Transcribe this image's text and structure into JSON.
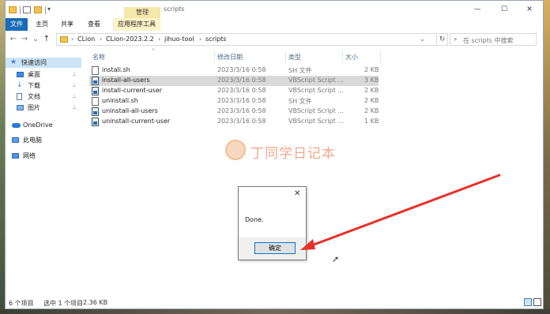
{
  "window": {
    "title": "scripts",
    "context_tab": "管理",
    "controls": {
      "minimize": "—",
      "maximize": "☐",
      "close": "✕"
    }
  },
  "ribbon": {
    "tabs": [
      "文件",
      "主页",
      "共享",
      "查看",
      "应用程序工具"
    ],
    "colors": {
      "file_tab": "#1a6cb8",
      "context_tab": "#f6e8a8"
    }
  },
  "navigation": {
    "back": "←",
    "forward": "→",
    "recent": "⌄",
    "up": "↑",
    "breadcrumb": [
      "CLion",
      "CLion-2023.2.2",
      "jihuo-tool",
      "scripts"
    ],
    "separator": "›",
    "refresh": "↻",
    "search_placeholder": "在 scripts 中搜索",
    "help": "?"
  },
  "sidebar": {
    "items": [
      {
        "label": "快速访问",
        "icon": "star-icon",
        "pinned": false,
        "selected": true
      },
      {
        "label": "桌面",
        "icon": "desktop-icon",
        "pinned": true
      },
      {
        "label": "下载",
        "icon": "download-icon",
        "pinned": true
      },
      {
        "label": "文档",
        "icon": "documents-icon",
        "pinned": true
      },
      {
        "label": "图片",
        "icon": "pictures-icon",
        "pinned": true
      },
      {
        "label": "OneDrive",
        "icon": "cloud-icon",
        "pinned": false
      },
      {
        "label": "此电脑",
        "icon": "computer-icon",
        "pinned": false
      },
      {
        "label": "网络",
        "icon": "network-icon",
        "pinned": false
      }
    ],
    "pin_glyph": "📌"
  },
  "file_list": {
    "columns": [
      "名称",
      "修改日期",
      "类型",
      "大小"
    ],
    "sort_indicator": "^",
    "rows": [
      {
        "name": "install.sh",
        "date": "2023/3/16 0:58",
        "type": "SH 文件",
        "size": "2 KB",
        "icon": "file-icon",
        "selected": false
      },
      {
        "name": "install-all-users",
        "date": "2023/3/16 0:58",
        "type": "VBScript Script ...",
        "size": "3 KB",
        "icon": "vbscript-icon",
        "selected": true
      },
      {
        "name": "install-current-user",
        "date": "2023/3/16 0:58",
        "type": "VBScript Script ...",
        "size": "2 KB",
        "icon": "vbscript-icon",
        "selected": false
      },
      {
        "name": "uninstall.sh",
        "date": "2023/3/16 0:58",
        "type": "SH 文件",
        "size": "2 KB",
        "icon": "file-icon",
        "selected": false
      },
      {
        "name": "uninstall-all-users",
        "date": "2023/3/16 0:58",
        "type": "VBScript Script ...",
        "size": "2 KB",
        "icon": "vbscript-icon",
        "selected": false
      },
      {
        "name": "uninstall-current-user",
        "date": "2023/3/16 0:58",
        "type": "VBScript Script ...",
        "size": "1 KB",
        "icon": "vbscript-icon",
        "selected": false
      }
    ]
  },
  "watermark": {
    "text": "丁同学日记本",
    "icon": "shiba-dog-icon"
  },
  "status": {
    "count": "6 个项目",
    "selection": "选中 1 个项目",
    "size": "2.36 KB"
  },
  "dialog": {
    "message": "Done.",
    "ok_label": "确定",
    "close": "✕"
  },
  "annotation": {
    "arrow_color": "#e8302a"
  }
}
